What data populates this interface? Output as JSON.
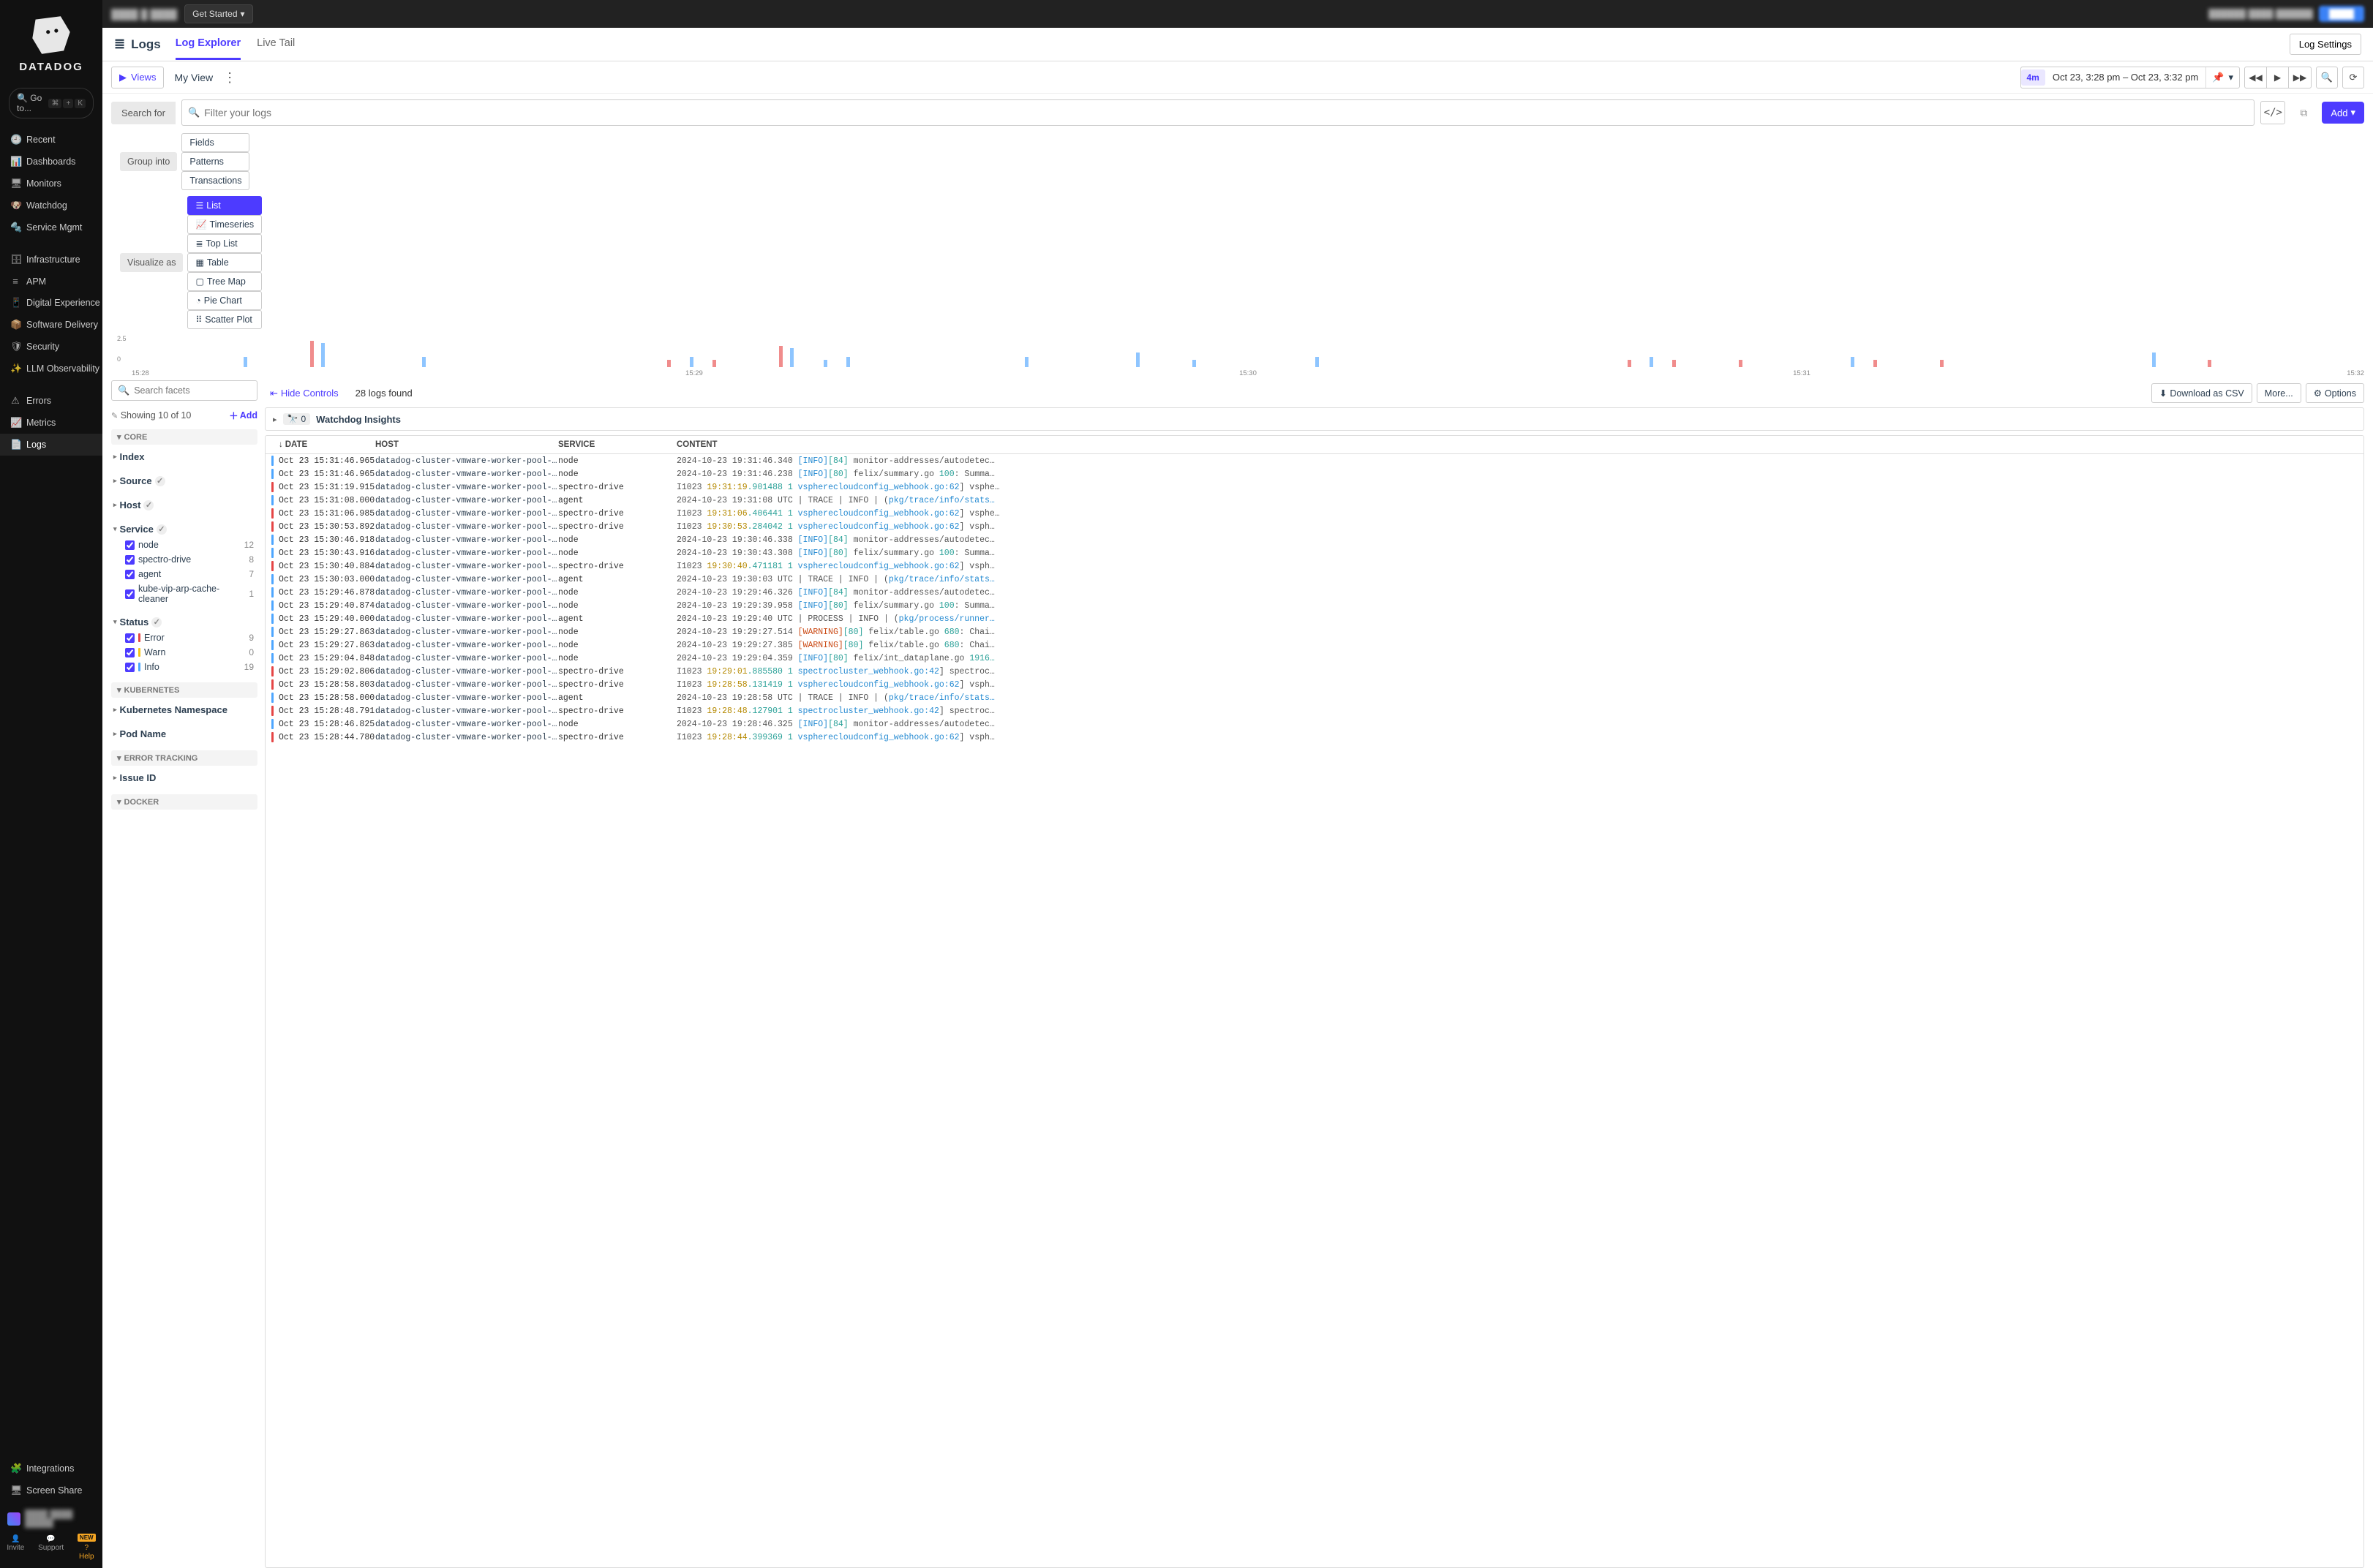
{
  "brand": "DATADOG",
  "goto": {
    "label": "Go to...",
    "keys": [
      "⌘",
      "+",
      "K"
    ]
  },
  "nav": [
    {
      "icon": "🕘",
      "label": "Recent"
    },
    {
      "icon": "📊",
      "label": "Dashboards"
    },
    {
      "icon": "🖥",
      "label": "Monitors"
    },
    {
      "icon": "🐶",
      "label": "Watchdog"
    },
    {
      "icon": "🔩",
      "label": "Service Mgmt"
    },
    {
      "spacer": true
    },
    {
      "icon": "🗄",
      "label": "Infrastructure"
    },
    {
      "icon": "≡",
      "label": "APM"
    },
    {
      "icon": "📱",
      "label": "Digital Experience"
    },
    {
      "icon": "📦",
      "label": "Software Delivery"
    },
    {
      "icon": "🛡",
      "label": "Security"
    },
    {
      "icon": "✨",
      "label": "LLM Observability"
    },
    {
      "spacer": true
    },
    {
      "icon": "⚠",
      "label": "Errors"
    },
    {
      "icon": "📈",
      "label": "Metrics"
    },
    {
      "icon": "📄",
      "label": "Logs",
      "active": true
    },
    {
      "spacer": true
    }
  ],
  "nav_bottom": [
    {
      "icon": "🧩",
      "label": "Integrations"
    },
    {
      "icon": "🖥",
      "label": "Screen Share"
    }
  ],
  "nav_actions": [
    {
      "icon": "👤",
      "label": "Invite"
    },
    {
      "icon": "💬",
      "label": "Support"
    },
    {
      "icon": "?",
      "label": "Help",
      "badge": "NEW",
      "cls": "help"
    }
  ],
  "topbar": {
    "get_started": "Get Started"
  },
  "page": {
    "title": "Logs",
    "tabs": [
      "Log Explorer",
      "Live Tail"
    ],
    "active_tab": 0,
    "log_settings": "Log Settings"
  },
  "viewrow": {
    "views_btn": "Views",
    "my_view": "My View",
    "time_pill": "4m",
    "time_range": "Oct 23, 3:28 pm – Oct 23, 3:32 pm"
  },
  "search": {
    "label": "Search for",
    "placeholder": "Filter your logs",
    "add": "Add"
  },
  "group_into": {
    "label": "Group into",
    "options": [
      "Fields",
      "Patterns",
      "Transactions"
    ]
  },
  "visualize": {
    "label": "Visualize as",
    "options": [
      {
        "icon": "☰",
        "label": "List",
        "active": true
      },
      {
        "icon": "📈",
        "label": "Timeseries"
      },
      {
        "icon": "≣",
        "label": "Top List"
      },
      {
        "icon": "▦",
        "label": "Table"
      },
      {
        "icon": "▢",
        "label": "Tree Map"
      },
      {
        "icon": "◔",
        "label": "Pie Chart"
      },
      {
        "icon": "⠿",
        "label": "Scatter Plot"
      }
    ]
  },
  "chart_data": {
    "type": "bar",
    "ylim": [
      0,
      2.5
    ],
    "yticks": [
      0,
      2.5
    ],
    "xlabels": [
      "15:28",
      "15:29",
      "15:30",
      "15:31",
      "15:32"
    ],
    "bars": [
      {
        "pos": 5,
        "h": 1,
        "color": "blue"
      },
      {
        "pos": 8,
        "h": 2.5,
        "color": "red"
      },
      {
        "pos": 8.5,
        "h": 2.3,
        "color": "blue"
      },
      {
        "pos": 13,
        "h": 1,
        "color": "blue"
      },
      {
        "pos": 24,
        "h": 0.7,
        "color": "red"
      },
      {
        "pos": 25,
        "h": 1,
        "color": "blue"
      },
      {
        "pos": 26,
        "h": 0.7,
        "color": "red"
      },
      {
        "pos": 29,
        "h": 2,
        "color": "red"
      },
      {
        "pos": 29.5,
        "h": 1.8,
        "color": "blue"
      },
      {
        "pos": 31,
        "h": 0.7,
        "color": "blue"
      },
      {
        "pos": 32,
        "h": 1,
        "color": "blue"
      },
      {
        "pos": 40,
        "h": 1,
        "color": "blue"
      },
      {
        "pos": 45,
        "h": 1.4,
        "color": "blue"
      },
      {
        "pos": 47.5,
        "h": 0.7,
        "color": "blue"
      },
      {
        "pos": 53,
        "h": 1,
        "color": "blue"
      },
      {
        "pos": 67,
        "h": 0.7,
        "color": "red"
      },
      {
        "pos": 68,
        "h": 1,
        "color": "blue"
      },
      {
        "pos": 69,
        "h": 0.7,
        "color": "red"
      },
      {
        "pos": 72,
        "h": 0.7,
        "color": "red"
      },
      {
        "pos": 77,
        "h": 1,
        "color": "blue"
      },
      {
        "pos": 78,
        "h": 0.7,
        "color": "red"
      },
      {
        "pos": 81,
        "h": 0.7,
        "color": "red"
      },
      {
        "pos": 90.5,
        "h": 1.4,
        "color": "blue"
      },
      {
        "pos": 93,
        "h": 0.7,
        "color": "red"
      }
    ]
  },
  "facets": {
    "search_placeholder": "Search facets",
    "showing": "Showing 10 of 10",
    "add": "Add",
    "sections": [
      {
        "title": "CORE",
        "groups": [
          {
            "name": "Index",
            "expanded": false
          },
          {
            "name": "Source",
            "badge": true,
            "expanded": false
          },
          {
            "name": "Host",
            "badge": true,
            "expanded": false
          },
          {
            "name": "Service",
            "badge": true,
            "expanded": true,
            "items": [
              {
                "label": "node",
                "count": 12,
                "checked": true
              },
              {
                "label": "spectro-drive",
                "count": 8,
                "checked": true
              },
              {
                "label": "agent",
                "count": 7,
                "checked": true
              },
              {
                "label": "kube-vip-arp-cache-cleaner",
                "count": 1,
                "checked": true
              }
            ]
          },
          {
            "name": "Status",
            "badge": true,
            "expanded": true,
            "items": [
              {
                "label": "Error",
                "dot": "red",
                "count": 9,
                "checked": true
              },
              {
                "label": "Warn",
                "dot": "yellow",
                "count": 0,
                "checked": true
              },
              {
                "label": "Info",
                "dot": "blue",
                "count": 19,
                "checked": true
              }
            ]
          }
        ]
      },
      {
        "title": "KUBERNETES",
        "groups": [
          {
            "name": "Kubernetes Namespace",
            "expanded": false
          },
          {
            "name": "Pod Name",
            "expanded": false
          }
        ]
      },
      {
        "title": "ERROR TRACKING",
        "groups": [
          {
            "name": "Issue ID",
            "expanded": false
          }
        ]
      },
      {
        "title": "DOCKER",
        "groups": []
      }
    ]
  },
  "log_tools": {
    "hide_controls": "Hide Controls",
    "logs_found": "28 logs found",
    "download": "Download as CSV",
    "more": "More...",
    "options": "Options"
  },
  "watchdog": {
    "count": "0",
    "label": "Watchdog Insights"
  },
  "columns": [
    "DATE",
    "HOST",
    "SERVICE",
    "CONTENT"
  ],
  "logs": [
    {
      "status": "blue",
      "date": "Oct 23 15:31:46.965",
      "host": "datadog-cluster-vmware-worker-pool-clus…",
      "service": "node",
      "content": [
        {
          "cls": "rest",
          "t": "2024-10-23 19:31:46.340 "
        },
        {
          "cls": "info",
          "t": "[INFO]"
        },
        {
          "cls": "num",
          "t": "[84]"
        },
        {
          "cls": "rest",
          "t": " monitor-addresses/autodetec…"
        }
      ]
    },
    {
      "status": "blue",
      "date": "Oct 23 15:31:46.965",
      "host": "datadog-cluster-vmware-worker-pool-clus…",
      "service": "node",
      "content": [
        {
          "cls": "rest",
          "t": "2024-10-23 19:31:46.238 "
        },
        {
          "cls": "info",
          "t": "[INFO]"
        },
        {
          "cls": "num",
          "t": "[80]"
        },
        {
          "cls": "rest",
          "t": " felix/summary.go "
        },
        {
          "cls": "num",
          "t": "100"
        },
        {
          "cls": "rest",
          "t": ": Summa…"
        }
      ]
    },
    {
      "status": "red",
      "date": "Oct 23 15:31:19.915",
      "host": "datadog-cluster-vmware-worker-pool-clus…",
      "service": "spectro-drive",
      "content": [
        {
          "cls": "rest",
          "t": "I1023 "
        },
        {
          "cls": "ts",
          "t": "19:31:19"
        },
        {
          "cls": "num",
          "t": ".901488 1 "
        },
        {
          "cls": "path",
          "t": "vspherecloudconfig_webhook.go:62"
        },
        {
          "cls": "rest",
          "t": "] vsphe…"
        }
      ]
    },
    {
      "status": "blue",
      "date": "Oct 23 15:31:08.000",
      "host": "datadog-cluster-vmware-worker-pool-clus…",
      "service": "agent",
      "content": [
        {
          "cls": "rest",
          "t": "2024-10-23 19:31:08 UTC | TRACE | INFO | ("
        },
        {
          "cls": "path",
          "t": "pkg/trace/info/stats…"
        }
      ]
    },
    {
      "status": "red",
      "date": "Oct 23 15:31:06.985",
      "host": "datadog-cluster-vmware-worker-pool-clus…",
      "service": "spectro-drive",
      "content": [
        {
          "cls": "rest",
          "t": "I1023 "
        },
        {
          "cls": "ts",
          "t": "19:31:06"
        },
        {
          "cls": "num",
          "t": ".406441 1 "
        },
        {
          "cls": "path",
          "t": "vspherecloudconfig_webhook.go:62"
        },
        {
          "cls": "rest",
          "t": "] vsphe…"
        }
      ]
    },
    {
      "status": "red",
      "date": "Oct 23 15:30:53.892",
      "host": "datadog-cluster-vmware-worker-pool-clus…",
      "service": "spectro-drive",
      "content": [
        {
          "cls": "rest",
          "t": "I1023 "
        },
        {
          "cls": "ts",
          "t": "19:30:53"
        },
        {
          "cls": "num",
          "t": ".284042 1 "
        },
        {
          "cls": "path",
          "t": "vspherecloudconfig_webhook.go:62"
        },
        {
          "cls": "rest",
          "t": "] vsph…"
        }
      ]
    },
    {
      "status": "blue",
      "date": "Oct 23 15:30:46.918",
      "host": "datadog-cluster-vmware-worker-pool-clus…",
      "service": "node",
      "content": [
        {
          "cls": "rest",
          "t": "2024-10-23 19:30:46.338 "
        },
        {
          "cls": "info",
          "t": "[INFO]"
        },
        {
          "cls": "num",
          "t": "[84]"
        },
        {
          "cls": "rest",
          "t": " monitor-addresses/autodetec…"
        }
      ]
    },
    {
      "status": "blue",
      "date": "Oct 23 15:30:43.916",
      "host": "datadog-cluster-vmware-worker-pool-clus…",
      "service": "node",
      "content": [
        {
          "cls": "rest",
          "t": "2024-10-23 19:30:43.308 "
        },
        {
          "cls": "info",
          "t": "[INFO]"
        },
        {
          "cls": "num",
          "t": "[80]"
        },
        {
          "cls": "rest",
          "t": " felix/summary.go "
        },
        {
          "cls": "num",
          "t": "100"
        },
        {
          "cls": "rest",
          "t": ": Summa…"
        }
      ]
    },
    {
      "status": "red",
      "date": "Oct 23 15:30:40.884",
      "host": "datadog-cluster-vmware-worker-pool-clus…",
      "service": "spectro-drive",
      "content": [
        {
          "cls": "rest",
          "t": "I1023 "
        },
        {
          "cls": "ts",
          "t": "19:30:40"
        },
        {
          "cls": "num",
          "t": ".471181 1 "
        },
        {
          "cls": "path",
          "t": "vspherecloudconfig_webhook.go:62"
        },
        {
          "cls": "rest",
          "t": "] vsph…"
        }
      ]
    },
    {
      "status": "blue",
      "date": "Oct 23 15:30:03.000",
      "host": "datadog-cluster-vmware-worker-pool-clus…",
      "service": "agent",
      "content": [
        {
          "cls": "rest",
          "t": "2024-10-23 19:30:03 UTC | TRACE | INFO | ("
        },
        {
          "cls": "path",
          "t": "pkg/trace/info/stats…"
        }
      ]
    },
    {
      "status": "blue",
      "date": "Oct 23 15:29:46.878",
      "host": "datadog-cluster-vmware-worker-pool-clus…",
      "service": "node",
      "content": [
        {
          "cls": "rest",
          "t": "2024-10-23 19:29:46.326 "
        },
        {
          "cls": "info",
          "t": "[INFO]"
        },
        {
          "cls": "num",
          "t": "[84]"
        },
        {
          "cls": "rest",
          "t": " monitor-addresses/autodetec…"
        }
      ]
    },
    {
      "status": "blue",
      "date": "Oct 23 15:29:40.874",
      "host": "datadog-cluster-vmware-worker-pool-clus…",
      "service": "node",
      "content": [
        {
          "cls": "rest",
          "t": "2024-10-23 19:29:39.958 "
        },
        {
          "cls": "info",
          "t": "[INFO]"
        },
        {
          "cls": "num",
          "t": "[80]"
        },
        {
          "cls": "rest",
          "t": " felix/summary.go "
        },
        {
          "cls": "num",
          "t": "100"
        },
        {
          "cls": "rest",
          "t": ": Summa…"
        }
      ]
    },
    {
      "status": "blue",
      "date": "Oct 23 15:29:40.000",
      "host": "datadog-cluster-vmware-worker-pool-clus…",
      "service": "agent",
      "content": [
        {
          "cls": "rest",
          "t": "2024-10-23 19:29:40 UTC | PROCESS | INFO | ("
        },
        {
          "cls": "path",
          "t": "pkg/process/runner…"
        }
      ]
    },
    {
      "status": "blue",
      "date": "Oct 23 15:29:27.863",
      "host": "datadog-cluster-vmware-worker-pool-clus…",
      "service": "node",
      "content": [
        {
          "cls": "rest",
          "t": "2024-10-23 19:29:27.514 "
        },
        {
          "cls": "warn",
          "t": "[WARNING]"
        },
        {
          "cls": "num",
          "t": "[80]"
        },
        {
          "cls": "rest",
          "t": " felix/table.go "
        },
        {
          "cls": "num",
          "t": "680"
        },
        {
          "cls": "rest",
          "t": ": Chai…"
        }
      ]
    },
    {
      "status": "blue",
      "date": "Oct 23 15:29:27.863",
      "host": "datadog-cluster-vmware-worker-pool-clus…",
      "service": "node",
      "content": [
        {
          "cls": "rest",
          "t": "2024-10-23 19:29:27.385 "
        },
        {
          "cls": "warn",
          "t": "[WARNING]"
        },
        {
          "cls": "num",
          "t": "[80]"
        },
        {
          "cls": "rest",
          "t": " felix/table.go "
        },
        {
          "cls": "num",
          "t": "680"
        },
        {
          "cls": "rest",
          "t": ": Chai…"
        }
      ]
    },
    {
      "status": "blue",
      "date": "Oct 23 15:29:04.848",
      "host": "datadog-cluster-vmware-worker-pool-clus…",
      "service": "node",
      "content": [
        {
          "cls": "rest",
          "t": "2024-10-23 19:29:04.359 "
        },
        {
          "cls": "info",
          "t": "[INFO]"
        },
        {
          "cls": "num",
          "t": "[80]"
        },
        {
          "cls": "rest",
          "t": " felix/int_dataplane.go "
        },
        {
          "cls": "num",
          "t": "1916…"
        }
      ]
    },
    {
      "status": "red",
      "date": "Oct 23 15:29:02.806",
      "host": "datadog-cluster-vmware-worker-pool-clus…",
      "service": "spectro-drive",
      "content": [
        {
          "cls": "rest",
          "t": "I1023 "
        },
        {
          "cls": "ts",
          "t": "19:29:01"
        },
        {
          "cls": "num",
          "t": ".885580 1 "
        },
        {
          "cls": "path",
          "t": "spectrocluster_webhook.go:42"
        },
        {
          "cls": "rest",
          "t": "] spectroc…"
        }
      ]
    },
    {
      "status": "red",
      "date": "Oct 23 15:28:58.803",
      "host": "datadog-cluster-vmware-worker-pool-clus…",
      "service": "spectro-drive",
      "content": [
        {
          "cls": "rest",
          "t": "I1023 "
        },
        {
          "cls": "ts",
          "t": "19:28:58"
        },
        {
          "cls": "num",
          "t": ".131419 1 "
        },
        {
          "cls": "path",
          "t": "vspherecloudconfig_webhook.go:62"
        },
        {
          "cls": "rest",
          "t": "] vsph…"
        }
      ]
    },
    {
      "status": "blue",
      "date": "Oct 23 15:28:58.000",
      "host": "datadog-cluster-vmware-worker-pool-clus…",
      "service": "agent",
      "content": [
        {
          "cls": "rest",
          "t": "2024-10-23 19:28:58 UTC | TRACE | INFO | ("
        },
        {
          "cls": "path",
          "t": "pkg/trace/info/stats…"
        }
      ]
    },
    {
      "status": "red",
      "date": "Oct 23 15:28:48.791",
      "host": "datadog-cluster-vmware-worker-pool-clus…",
      "service": "spectro-drive",
      "content": [
        {
          "cls": "rest",
          "t": "I1023 "
        },
        {
          "cls": "ts",
          "t": "19:28:48"
        },
        {
          "cls": "num",
          "t": ".127901 1 "
        },
        {
          "cls": "path",
          "t": "spectrocluster_webhook.go:42"
        },
        {
          "cls": "rest",
          "t": "] spectroc…"
        }
      ]
    },
    {
      "status": "blue",
      "date": "Oct 23 15:28:46.825",
      "host": "datadog-cluster-vmware-worker-pool-clus…",
      "service": "node",
      "content": [
        {
          "cls": "rest",
          "t": "2024-10-23 19:28:46.325 "
        },
        {
          "cls": "info",
          "t": "[INFO]"
        },
        {
          "cls": "num",
          "t": "[84]"
        },
        {
          "cls": "rest",
          "t": " monitor-addresses/autodetec…"
        }
      ]
    },
    {
      "status": "red",
      "date": "Oct 23 15:28:44.780",
      "host": "datadog-cluster-vmware-worker-pool-clus…",
      "service": "spectro-drive",
      "content": [
        {
          "cls": "rest",
          "t": "I1023 "
        },
        {
          "cls": "ts",
          "t": "19:28:44"
        },
        {
          "cls": "num",
          "t": ".399369 1 "
        },
        {
          "cls": "path",
          "t": "vspherecloudconfig_webhook.go:62"
        },
        {
          "cls": "rest",
          "t": "] vsph…"
        }
      ]
    }
  ]
}
